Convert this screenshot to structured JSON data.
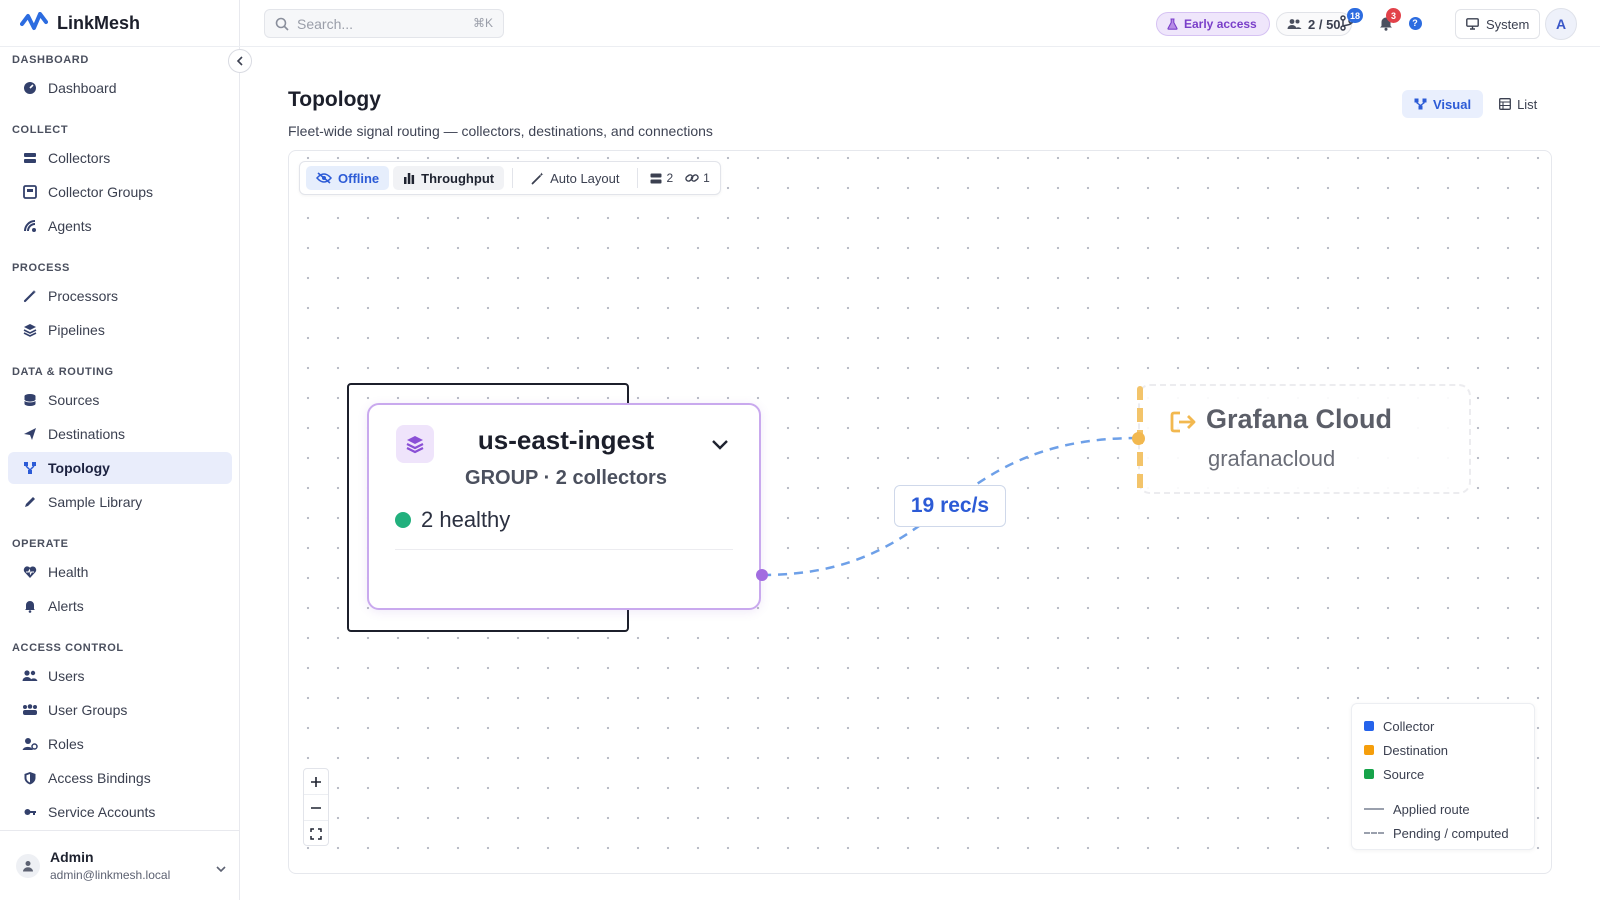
{
  "app": {
    "name": "LinkMesh"
  },
  "search": {
    "placeholder": "Search...",
    "shortcut": "⌘K"
  },
  "header": {
    "early_access": "Early access",
    "seats": "2 / 50",
    "pr_count": "18",
    "notif_count": "3",
    "help": "?",
    "system_label": "System",
    "avatar_initial": "A"
  },
  "sidebar": {
    "sections": [
      {
        "title": "DASHBOARD",
        "items": [
          {
            "label": "Dashboard",
            "icon": "dashboard-icon"
          }
        ]
      },
      {
        "title": "COLLECT",
        "items": [
          {
            "label": "Collectors",
            "icon": "server-icon"
          },
          {
            "label": "Collector Groups",
            "icon": "group-icon"
          },
          {
            "label": "Agents",
            "icon": "agent-icon"
          }
        ]
      },
      {
        "title": "PROCESS",
        "items": [
          {
            "label": "Processors",
            "icon": "wand-icon"
          },
          {
            "label": "Pipelines",
            "icon": "layers-icon"
          }
        ]
      },
      {
        "title": "DATA & ROUTING",
        "items": [
          {
            "label": "Sources",
            "icon": "database-icon"
          },
          {
            "label": "Destinations",
            "icon": "send-icon"
          },
          {
            "label": "Topology",
            "icon": "topology-icon",
            "active": true
          },
          {
            "label": "Sample Library",
            "icon": "pencil-icon"
          }
        ]
      },
      {
        "title": "OPERATE",
        "items": [
          {
            "label": "Health",
            "icon": "heart-pulse-icon"
          },
          {
            "label": "Alerts",
            "icon": "bell-icon"
          }
        ]
      },
      {
        "title": "ACCESS CONTROL",
        "items": [
          {
            "label": "Users",
            "icon": "users-icon"
          },
          {
            "label": "User Groups",
            "icon": "user-groups-icon"
          },
          {
            "label": "Roles",
            "icon": "role-icon"
          },
          {
            "label": "Access Bindings",
            "icon": "shield-icon"
          },
          {
            "label": "Service Accounts",
            "icon": "key-icon"
          }
        ]
      }
    ],
    "user": {
      "name": "Admin",
      "email": "admin@linkmesh.local"
    }
  },
  "page": {
    "title": "Topology",
    "subtitle": "Fleet-wide signal routing — collectors, destinations, and connections",
    "view_visual": "Visual",
    "view_list": "List"
  },
  "toolbar": {
    "offline": "Offline",
    "throughput": "Throughput",
    "auto_layout": "Auto Layout",
    "collector_count": "2",
    "link_count": "1"
  },
  "graph": {
    "group": {
      "name": "us-east-ingest",
      "subtitle": "GROUP · 2 collectors",
      "health": "2 healthy"
    },
    "edge": {
      "rate": "19 rec/s"
    },
    "destination": {
      "name": "Grafana Cloud",
      "type": "grafanacloud"
    }
  },
  "legend": {
    "items": [
      {
        "label": "Collector",
        "color": "#2563eb"
      },
      {
        "label": "Destination",
        "color": "#f59e0b"
      },
      {
        "label": "Source",
        "color": "#16a34a"
      }
    ],
    "applied": "Applied route",
    "pending": "Pending / computed"
  },
  "colors": {
    "accent": "#2c5bd6",
    "group": "#a26de0",
    "destination": "#f2b84f",
    "healthy": "#22b07d"
  }
}
